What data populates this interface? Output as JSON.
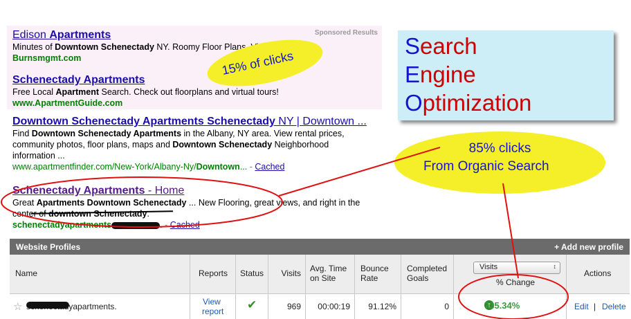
{
  "serp": {
    "sponsored_label": "Sponsored Results",
    "ads": [
      {
        "title_prefix": "Edison ",
        "title_bold": "Apartments",
        "desc_1": "Minutes of ",
        "desc_b1": "Downtown Schenectady",
        "desc_2": " NY. Roomy Floor Plans. Visit us today!",
        "url": "Burnsmgmt.com"
      },
      {
        "title": "Schenectady Apartments",
        "desc_1": "Free Local ",
        "desc_b1": "Apartment",
        "desc_2": " Search. Check out floorplans and virtual tours!",
        "url": "www.ApartmentGuide.com"
      }
    ],
    "organic": [
      {
        "title_bold": "Downtown Schenectady Apartments Schenectady",
        "title_plain": " NY | Downtown ...",
        "d1": "Find ",
        "d1b": "Downtown Schenectady Apartments",
        "d1r": " in the Albany, NY area. View rental prices,",
        "d2": "community photos, floor plans, maps and ",
        "d2b": "Downtown Schenectady",
        "d2r": " Neighborhood",
        "d3": "information ...",
        "url_1": "www.apartmentfinder.com",
        "url_2": "/New-York/Albany-Ny/",
        "url_3": "Downtown",
        "url_4": "...",
        "dash": " - ",
        "cached": "Cached"
      },
      {
        "title_bold": "Schenectady Apartments",
        "title_plain": " - Home",
        "d1": "Great ",
        "d1b": "Apartments Downtown Schenectady",
        "d1r": " ... New Flooring, great views, and right in the",
        "d2": "center of ",
        "d2b": "downtown Schenectady",
        "d2r": ".",
        "url_1": "schenectadyapartments",
        "url_4": ".",
        "dash": " - ",
        "cached": "Cached"
      }
    ]
  },
  "seo_box": {
    "lines": [
      {
        "initial": "S",
        "rest": "earch"
      },
      {
        "initial": "E",
        "rest": "ngine"
      },
      {
        "initial": "O",
        "rest": "ptimization"
      }
    ]
  },
  "callouts": {
    "paid": "15%  of clicks",
    "organic_1": "85% clicks",
    "organic_2": "From Organic Search"
  },
  "ga": {
    "header_title": "Website Profiles",
    "add_profile": "+ Add new profile",
    "columns": {
      "name": "Name",
      "reports": "Reports",
      "status": "Status",
      "visits": "Visits",
      "avg_1": "Avg. Time",
      "avg_2": "on Site",
      "bounce_1": "Bounce",
      "bounce_2": "Rate",
      "goals_1": "Completed",
      "goals_2": "Goals",
      "metric_select": "Visits",
      "pct_change": "% Change",
      "actions": "Actions"
    },
    "row": {
      "name": "schenectadyapartments.",
      "view_1": "View",
      "view_2": "report",
      "status_icon": "check-icon",
      "visits": "969",
      "avg_time": "00:00:19",
      "bounce": "91.12%",
      "goals": "0",
      "pct_change": "735.34%",
      "edit": "Edit",
      "sep": "|",
      "delete": "Delete"
    }
  },
  "colors": {
    "annotation_red": "#e01010",
    "callout_yellow": "#f5ef2a",
    "seo_blue": "#1414cc",
    "seo_red": "#cc0000"
  }
}
